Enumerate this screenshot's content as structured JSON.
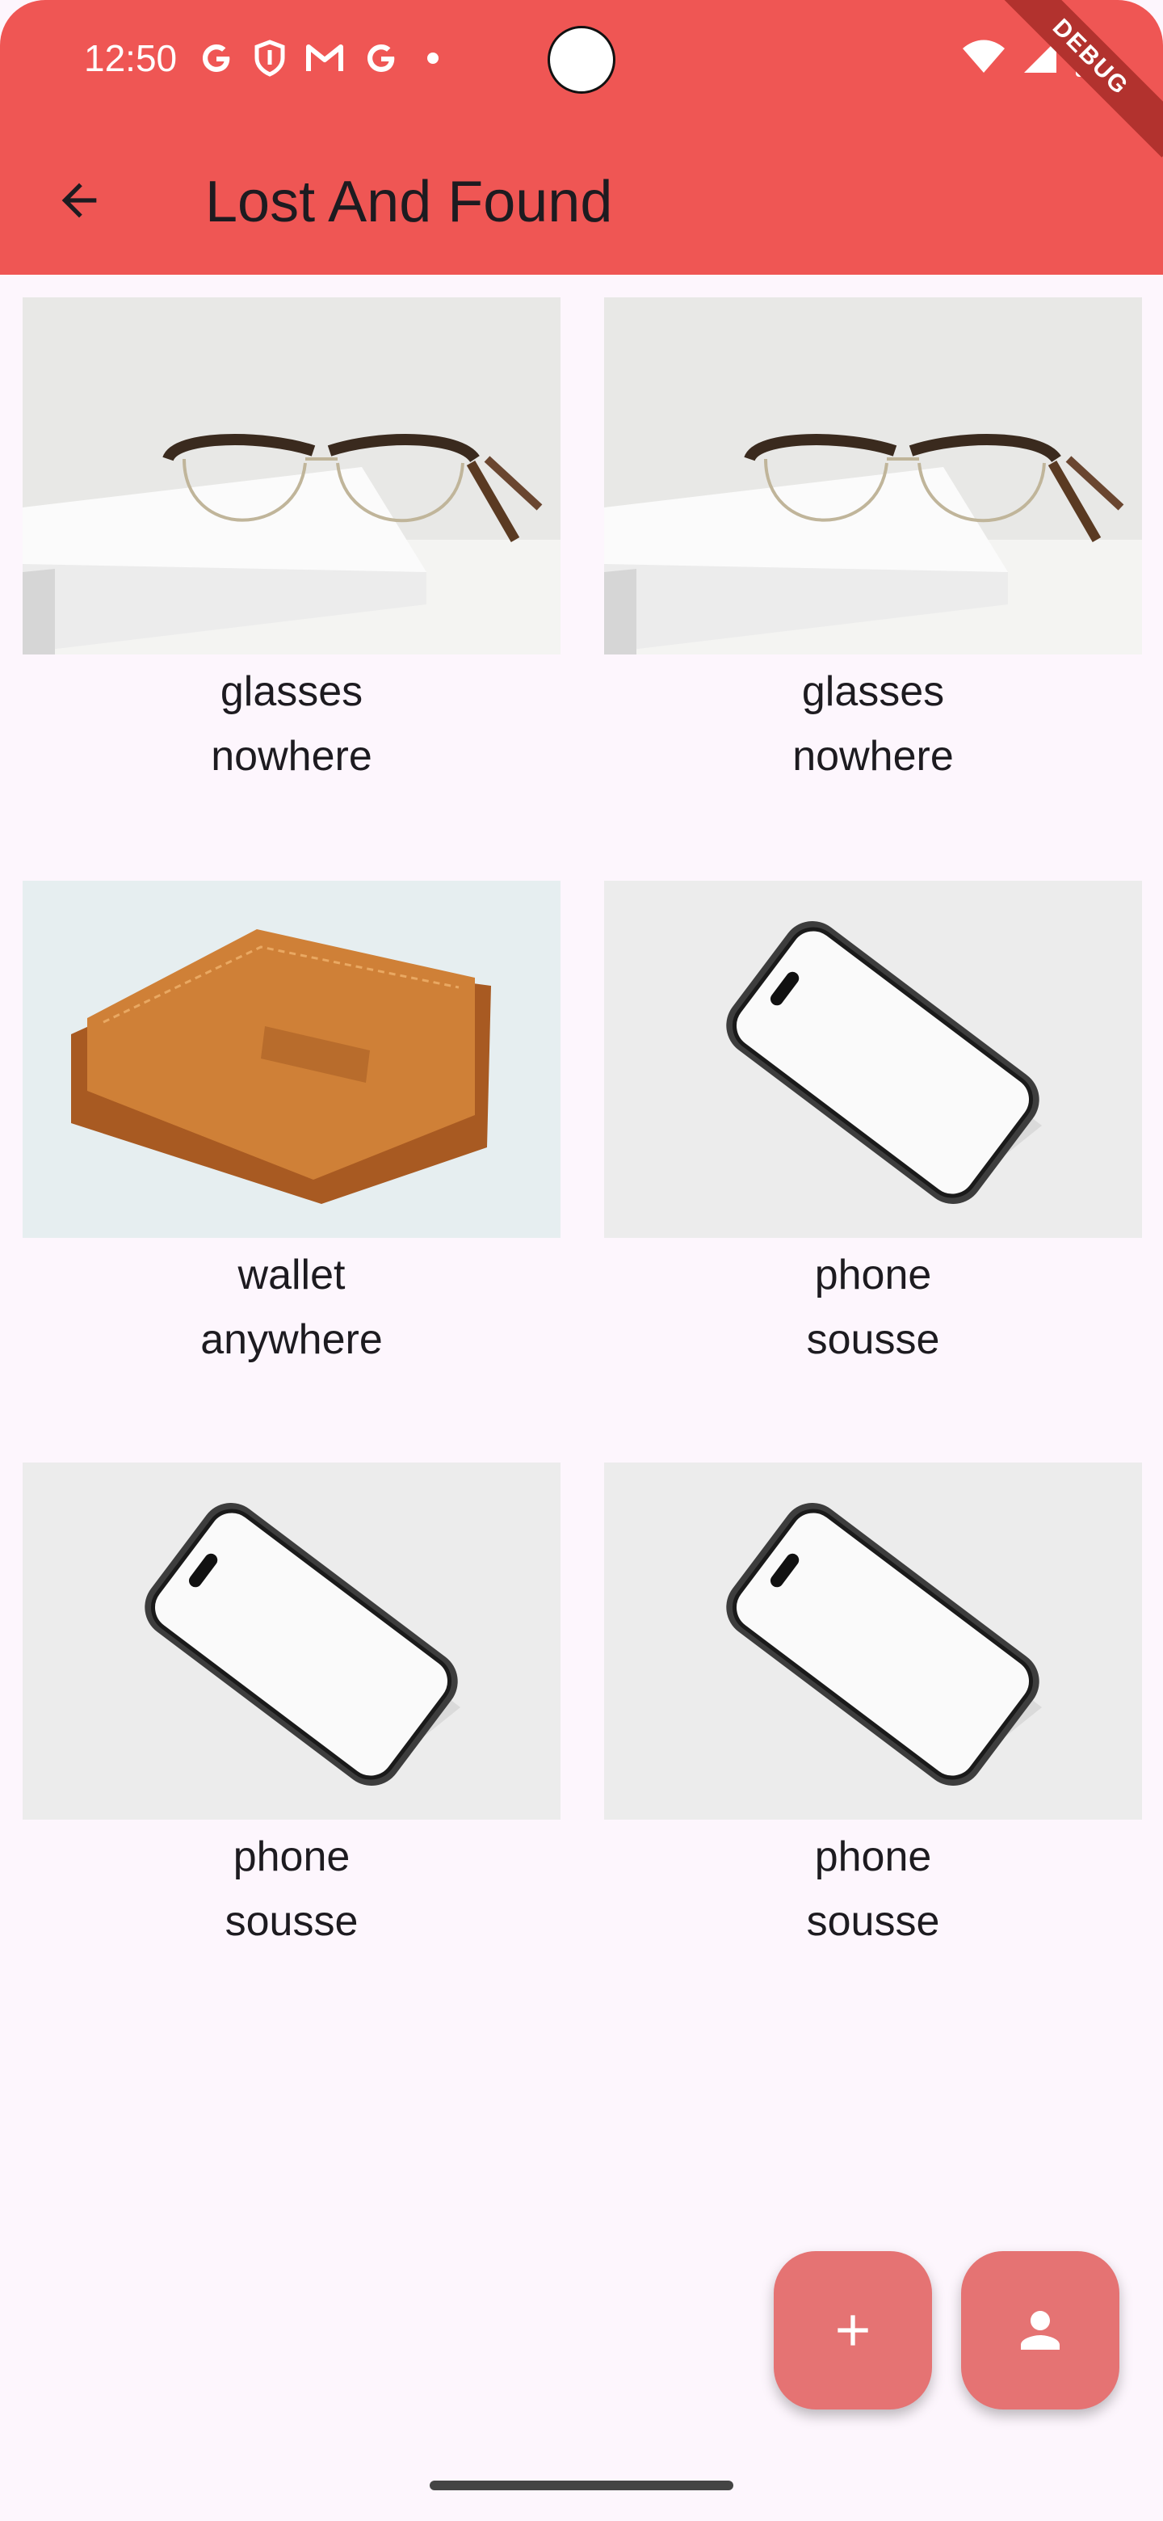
{
  "status_bar": {
    "time": "12:50",
    "icons": [
      "google-icon",
      "shield-icon",
      "gmail-icon",
      "google-icon",
      "dot-icon",
      "wifi-icon",
      "signal-icon",
      "battery-icon"
    ]
  },
  "debug_banner": "DEBUG",
  "app_bar": {
    "title": "Lost And Found",
    "back_icon": "arrow-back-icon",
    "background": "#ef5654"
  },
  "items": [
    {
      "name": "glasses",
      "location": "nowhere",
      "image": "glasses"
    },
    {
      "name": "glasses",
      "location": "nowhere",
      "image": "glasses"
    },
    {
      "name": "wallet",
      "location": "anywhere",
      "image": "wallet"
    },
    {
      "name": "phone",
      "location": "sousse",
      "image": "phone"
    },
    {
      "name": "phone",
      "location": "sousse",
      "image": "phone"
    },
    {
      "name": "phone",
      "location": "sousse",
      "image": "phone"
    }
  ],
  "fabs": [
    {
      "icon": "plus-icon"
    },
    {
      "icon": "person-icon"
    }
  ],
  "colors": {
    "accent": "#ef5654",
    "fab": "#e57373",
    "background": "#fdf6fd"
  }
}
